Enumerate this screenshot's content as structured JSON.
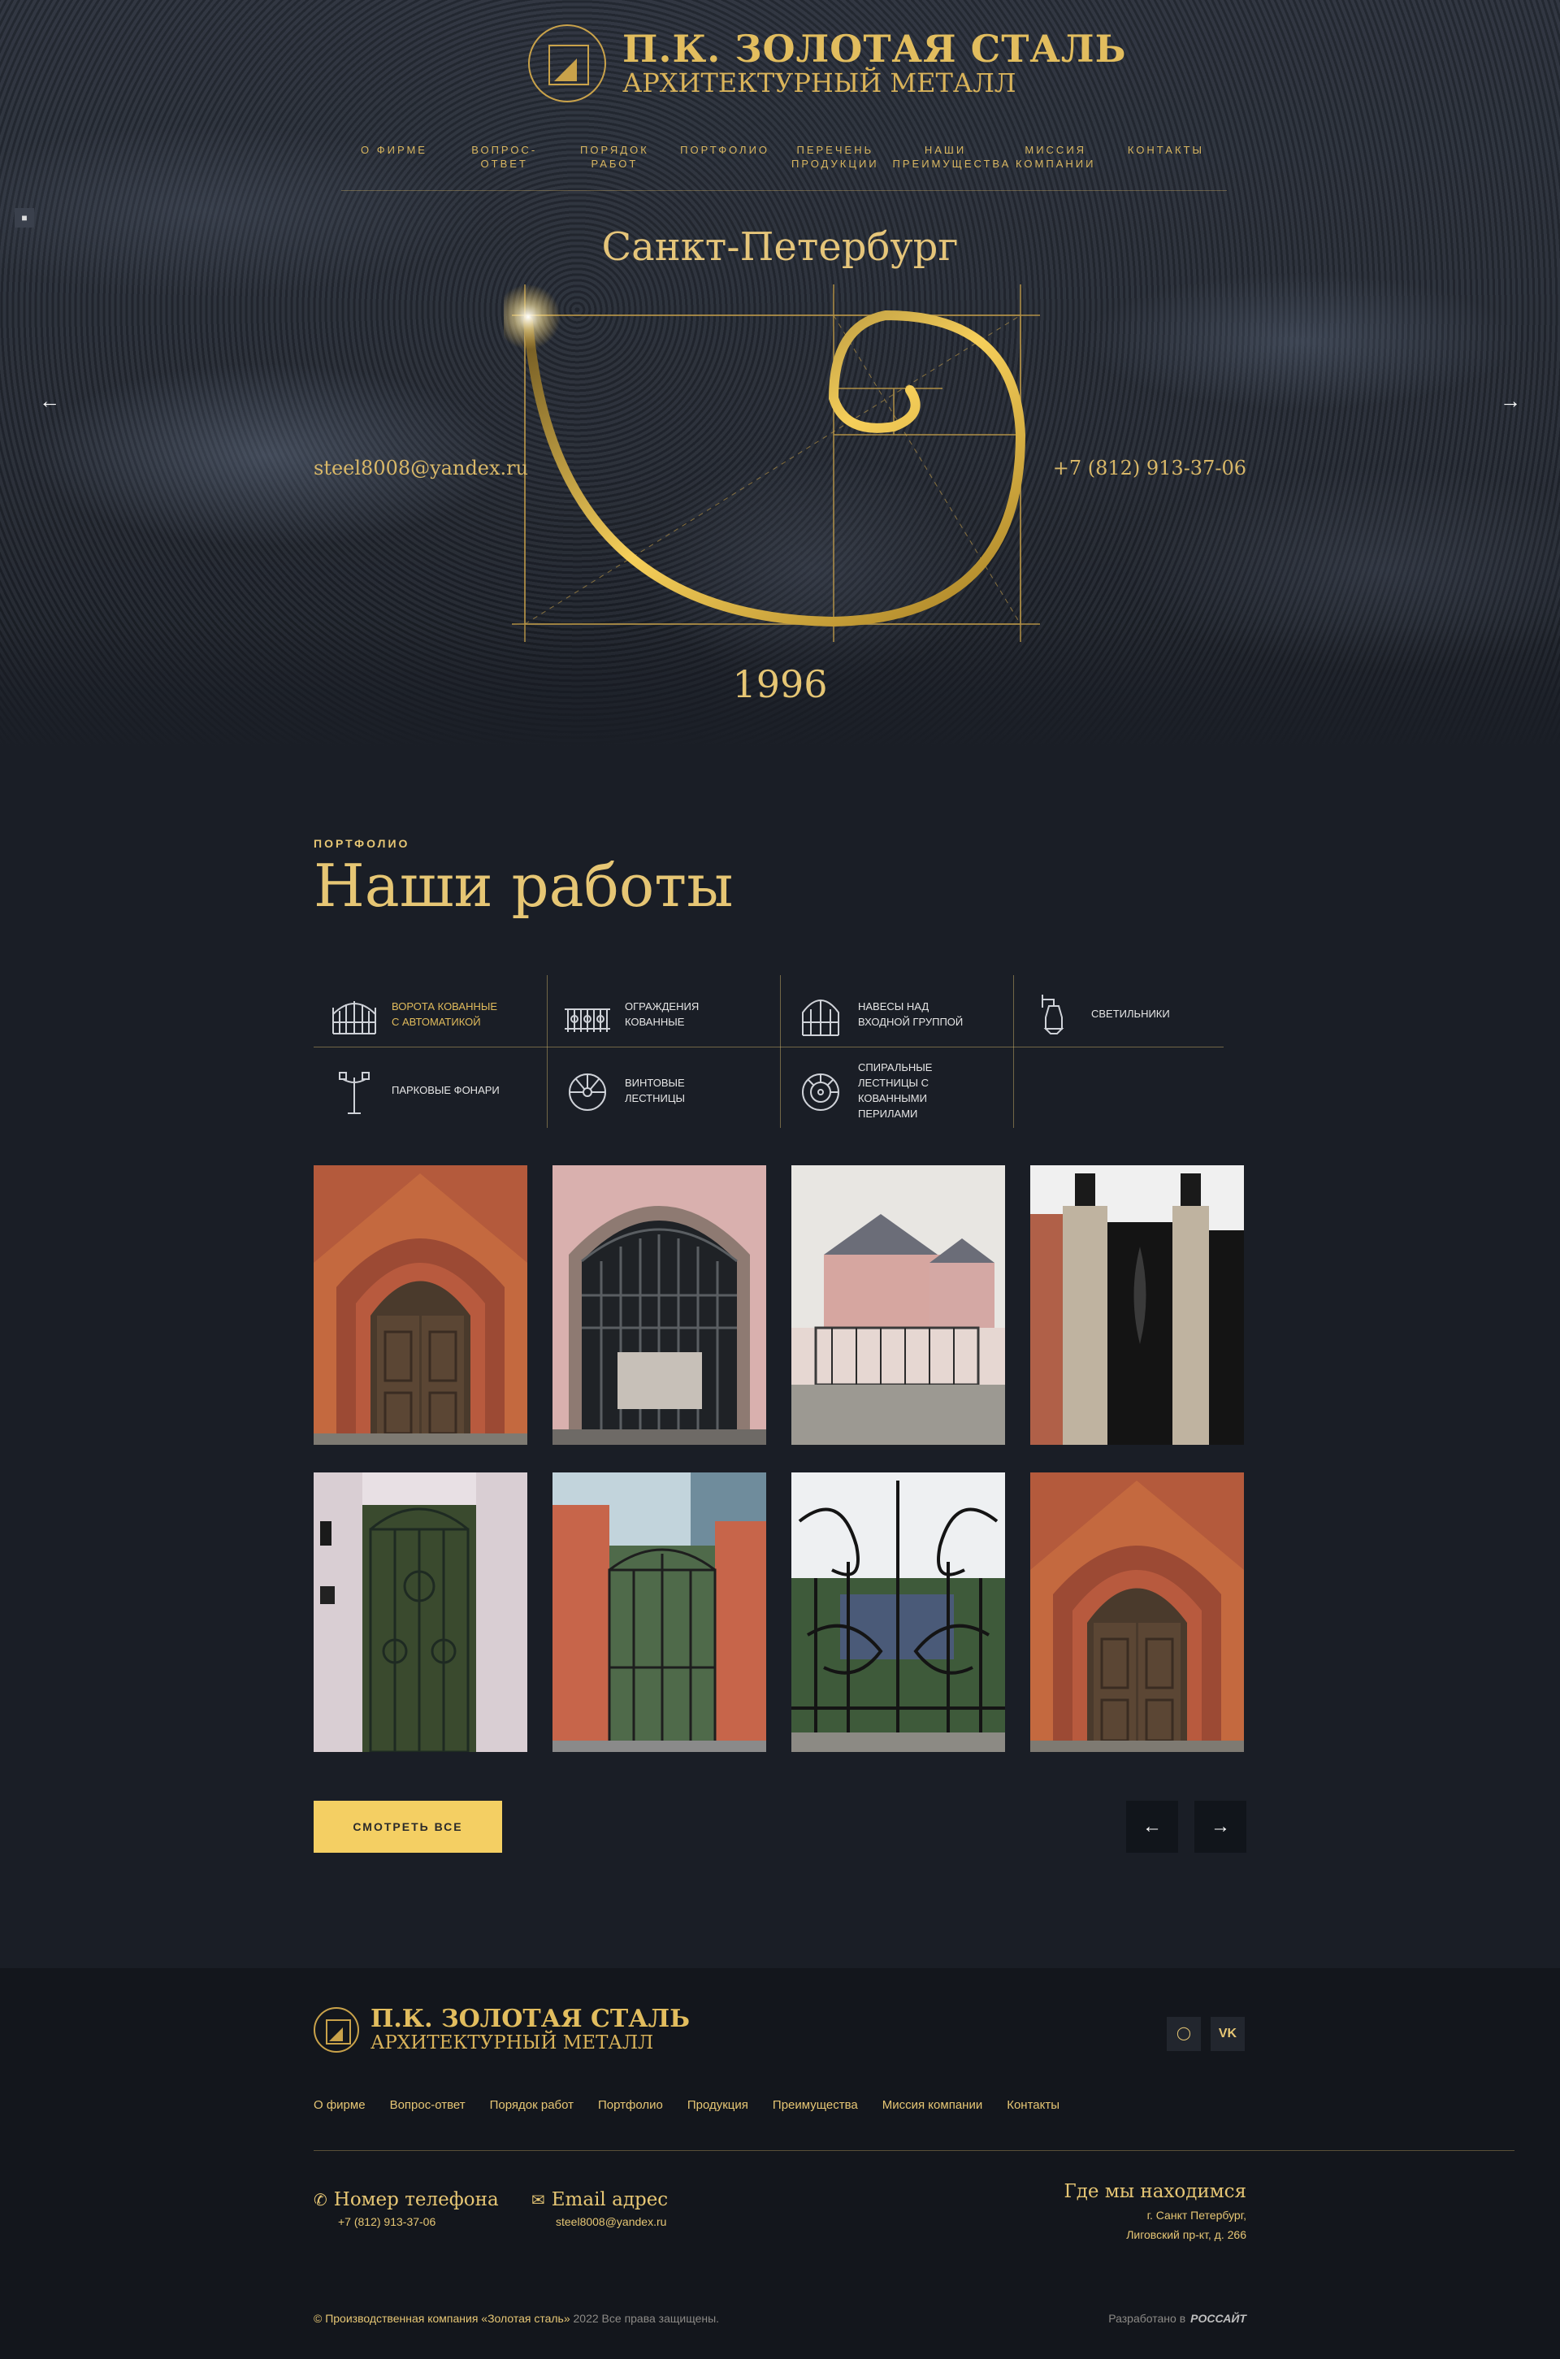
{
  "header": {
    "logo_line1": "П.К. ЗОЛОТАЯ СТАЛЬ",
    "logo_line2": "АРХИТЕКТУРНЫЙ МЕТАЛЛ",
    "nav": [
      {
        "line1": "О ФИРМЕ",
        "line2": ""
      },
      {
        "line1": "ВОПРОС-ОТВЕТ",
        "line2": ""
      },
      {
        "line1": "ПОРЯДОК",
        "line2": "РАБОТ"
      },
      {
        "line1": "ПОРТФОЛИО",
        "line2": ""
      },
      {
        "line1": "ПЕРЕЧЕНЬ",
        "line2": "ПРОДУКЦИИ"
      },
      {
        "line1": "НАШИ",
        "line2": "ПРЕИМУЩЕСТВА"
      },
      {
        "line1": "МИССИЯ",
        "line2": "КОМПАНИИ"
      },
      {
        "line1": "КОНТАКТЫ",
        "line2": ""
      }
    ]
  },
  "hero": {
    "city": "Санкт-Петербург",
    "email": "steel8008@yandex.ru",
    "phone": "+7 (812) 913-37-06",
    "year": "1996",
    "prev_icon": "arrow-left-icon",
    "next_icon": "arrow-right-icon"
  },
  "portfolio": {
    "kicker": "ПОРТФОЛИО",
    "title": "Наши работы",
    "categories": [
      {
        "line1": "ВОРОТА КОВАННЫЕ",
        "line2": "С АВТОМАТИКОЙ",
        "line3": "",
        "line4": "",
        "icon": "gate-icon",
        "active": true
      },
      {
        "line1": "ОГРАЖДЕНИЯ",
        "line2": "КОВАННЫЕ",
        "line3": "",
        "line4": "",
        "icon": "fence-icon",
        "active": false
      },
      {
        "line1": "НАВЕСЫ НАД",
        "line2": "ВХОДНОЙ ГРУППОЙ",
        "line3": "",
        "line4": "",
        "icon": "canopy-icon",
        "active": false
      },
      {
        "line1": "СВЕТИЛЬНИКИ",
        "line2": "",
        "line3": "",
        "line4": "",
        "icon": "lamp-icon",
        "active": false
      },
      {
        "line1": "ПАРКОВЫЕ ФОНАРИ",
        "line2": "",
        "line3": "",
        "line4": "",
        "icon": "street-lamp-icon",
        "active": false
      },
      {
        "line1": "ВИНТОВЫЕ",
        "line2": "ЛЕСТНИЦЫ",
        "line3": "",
        "line4": "",
        "icon": "spiral-stairs-icon",
        "active": false
      },
      {
        "line1": "СПИРАЛЬНЫЕ",
        "line2": "ЛЕСТНИЦЫ С",
        "line3": "КОВАННЫМИ",
        "line4": "ПЕРИЛАМИ",
        "icon": "spiral-railing-icon",
        "active": false
      }
    ],
    "view_all": "СМОТРЕТЬ ВСЕ"
  },
  "footer": {
    "logo_line1": "П.К. ЗОЛОТАЯ СТАЛЬ",
    "logo_line2": "АРХИТЕКТУРНЫЙ МЕТАЛЛ",
    "social": [
      "instagram-icon",
      "vk-icon"
    ],
    "nav": [
      "О фирме",
      "Вопрос-ответ",
      "Порядок работ",
      "Портфолио",
      "Продукция",
      "Преимущества",
      "Миссия компании",
      "Контакты"
    ],
    "phone_title": "Номер телефона",
    "phone_value": "+7 (812) 913-37-06",
    "email_title": "Email адрес",
    "email_value": "steel8008@yandex.ru",
    "location_title": "Где мы находимся",
    "location_line1": "г. Санкт Петербург,",
    "location_line2": "Лиговский пр-кт, д. 266",
    "copyright": "© Производственная компания «Золотая сталь»",
    "copyright_muted": "2022 Все права защищены.",
    "developer_label": "Разработано в",
    "developer_name": "РОССАЙТ"
  },
  "colors": {
    "gold": "#e6c674",
    "background": "#1a1e26",
    "footer_bg": "#13161c",
    "button": "#f4cf63"
  }
}
